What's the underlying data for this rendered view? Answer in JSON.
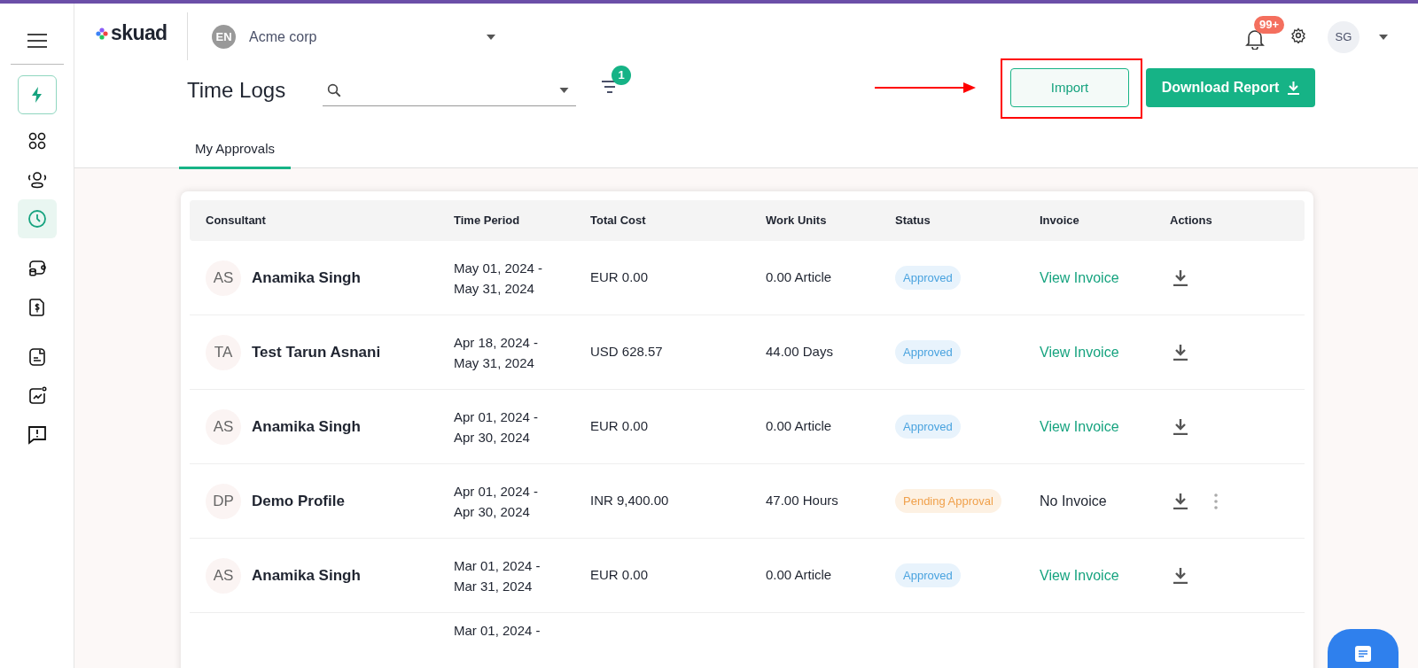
{
  "header": {
    "logo": "skuad",
    "org_badge": "EN",
    "org_name": "Acme corp",
    "notifications_badge": "99+",
    "user_initials": "SG"
  },
  "sidebar": {
    "items": [
      {
        "selected": false
      },
      {
        "selected": false
      },
      {
        "selected": false
      },
      {
        "selected": true
      },
      {
        "selected": false
      },
      {
        "selected": false
      },
      {
        "selected": false
      },
      {
        "selected": false
      },
      {
        "selected": false
      }
    ]
  },
  "page": {
    "title": "Time Logs",
    "filter_count": "1",
    "buttons": [
      {
        "label": "Import",
        "kind": "outline"
      },
      {
        "label": "Download Report",
        "kind": "primary"
      }
    ]
  },
  "tabs": [
    {
      "label": "My Approvals",
      "selected": true
    }
  ],
  "table": {
    "columns": [
      "Consultant",
      "Time Period",
      "Total Cost",
      "Work Units",
      "Status",
      "Invoice",
      "Actions"
    ],
    "rows": [
      {
        "initials": "AS",
        "name": "Anamika Singh",
        "period": [
          "May 01, 2024 -",
          "May 31, 2024"
        ],
        "cost": "EUR 0.00",
        "units": "0.00 Article",
        "status": {
          "label": "Approved",
          "kind": "approved"
        },
        "invoice": {
          "label": "View Invoice",
          "kind": "link"
        },
        "more": false
      },
      {
        "initials": "TA",
        "name": "Test Tarun Asnani",
        "period": [
          "Apr 18, 2024 -",
          "May 31, 2024"
        ],
        "cost": "USD 628.57",
        "units": "44.00 Days",
        "status": {
          "label": "Approved",
          "kind": "approved"
        },
        "invoice": {
          "label": "View Invoice",
          "kind": "link"
        },
        "more": false
      },
      {
        "initials": "AS",
        "name": "Anamika Singh",
        "period": [
          "Apr 01, 2024 -",
          "Apr 30, 2024"
        ],
        "cost": "EUR 0.00",
        "units": "0.00 Article",
        "status": {
          "label": "Approved",
          "kind": "approved"
        },
        "invoice": {
          "label": "View Invoice",
          "kind": "link"
        },
        "more": false
      },
      {
        "initials": "DP",
        "name": "Demo Profile",
        "period": [
          "Apr 01, 2024 -",
          "Apr 30, 2024"
        ],
        "cost": "INR 9,400.00",
        "units": "47.00 Hours",
        "status": {
          "label": "Pending Approval",
          "kind": "pending"
        },
        "invoice": {
          "label": "No Invoice",
          "kind": "none"
        },
        "more": true
      },
      {
        "initials": "AS",
        "name": "Anamika Singh",
        "period": [
          "Mar 01, 2024 -",
          "Mar 31, 2024"
        ],
        "cost": "EUR 0.00",
        "units": "0.00 Article",
        "status": {
          "label": "Approved",
          "kind": "approved"
        },
        "invoice": {
          "label": "View Invoice",
          "kind": "link"
        },
        "more": false
      },
      {
        "period": [
          "Mar 01, 2024 -"
        ]
      }
    ]
  }
}
